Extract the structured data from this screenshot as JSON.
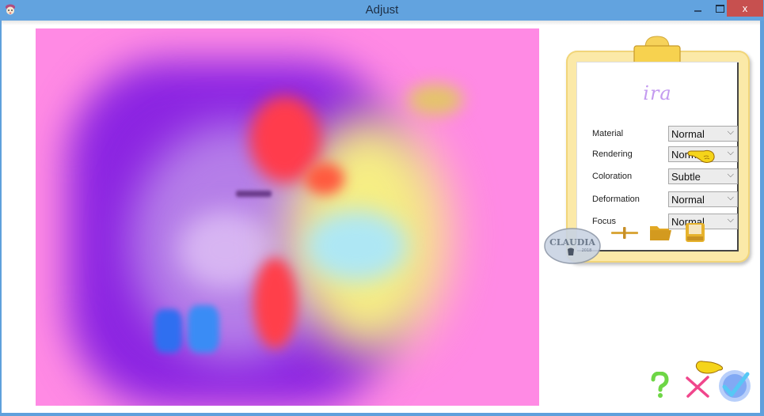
{
  "window": {
    "title": "Adjust",
    "controls": {
      "minimize": "–",
      "maximize": "□",
      "close": "x"
    }
  },
  "preview": {
    "label": "preview-image",
    "colors": {
      "background": "#ff8ae4",
      "purple": "#8a1fe0",
      "yellow": "#f5ef7a",
      "red": "#ff3f4a",
      "blue": "#2f7cf2"
    }
  },
  "panel": {
    "logo": "ira",
    "settings": [
      {
        "label": "Material",
        "value": "Normal"
      },
      {
        "label": "Rendering",
        "value": "Normal"
      },
      {
        "label": "Coloration",
        "value": "Subtle"
      },
      {
        "label": "Deformation",
        "value": "Normal"
      },
      {
        "label": "Focus",
        "value": "Normal"
      }
    ],
    "tools": [
      "reset-icon",
      "open-folder-icon",
      "save-icon"
    ],
    "watermark": {
      "text": "CLAUDIA",
      "subtext": "2018"
    }
  },
  "footer": {
    "help_icon": "?",
    "cancel_icon": "×",
    "ok_icon": "✓"
  },
  "annotations": {
    "pointer_hands": [
      "coloration-select",
      "cancel-ok-buttons"
    ]
  }
}
